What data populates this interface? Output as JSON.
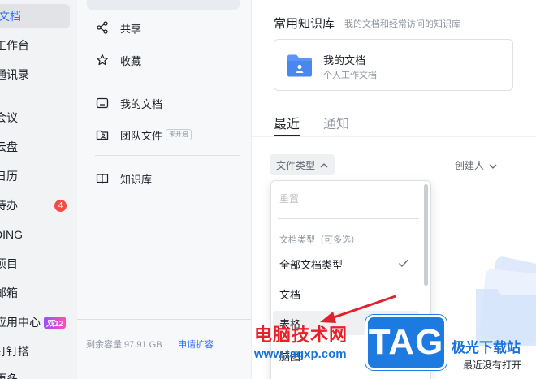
{
  "app_nav": {
    "items": [
      {
        "label": "文档",
        "active": true
      },
      {
        "label": "工作台"
      },
      {
        "label": "通讯录"
      },
      {
        "label": "会议"
      },
      {
        "label": "云盘"
      },
      {
        "label": "日历"
      },
      {
        "label": "待办",
        "badge": "4"
      },
      {
        "label": "DING"
      },
      {
        "label": "项目"
      },
      {
        "label": "邮箱"
      },
      {
        "label": "应用中心",
        "promo": "双12"
      },
      {
        "label": "钉钉搭"
      },
      {
        "label": "更多"
      }
    ]
  },
  "doc_nav": {
    "items": [
      {
        "label": "共享",
        "icon": "share-icon"
      },
      {
        "label": "收藏",
        "icon": "star-icon"
      },
      {
        "label": "我的文档",
        "icon": "my-docs-icon"
      },
      {
        "label": "团队文件",
        "icon": "team-files-icon",
        "tag": "未开启"
      },
      {
        "label": "知识库",
        "icon": "knowledge-base-icon"
      }
    ],
    "storage_text": "剩余容量 97.91 GB",
    "expand_link": "申请扩容"
  },
  "main": {
    "section_title": "常用知识库",
    "section_subtitle": "我的文档和经常访问的知识库",
    "kb_card": {
      "title": "我的文档",
      "subtitle": "个人工作文档"
    },
    "tabs": [
      {
        "label": "最近",
        "active": true
      },
      {
        "label": "通知",
        "active": false
      }
    ],
    "filter_label": "文件类型",
    "creator_label": "创建人",
    "empty_text": "最近没有打开"
  },
  "dropdown": {
    "reset": "重置",
    "group_label": "文档类型（可多选）",
    "options": [
      {
        "label": "全部文档类型",
        "checked": true
      },
      {
        "label": "文档"
      },
      {
        "label": "表格",
        "highlighted": true
      },
      {
        "label": "脑图"
      }
    ]
  },
  "watermark": {
    "site_cn": "电脑技术网",
    "site_url": "www.tagxp.com",
    "tag_logo": "TAG",
    "site_right": "极光下载站"
  },
  "colors": {
    "accent": "#3370ff",
    "badge": "#f54a45",
    "arrow": "#e0222c"
  }
}
